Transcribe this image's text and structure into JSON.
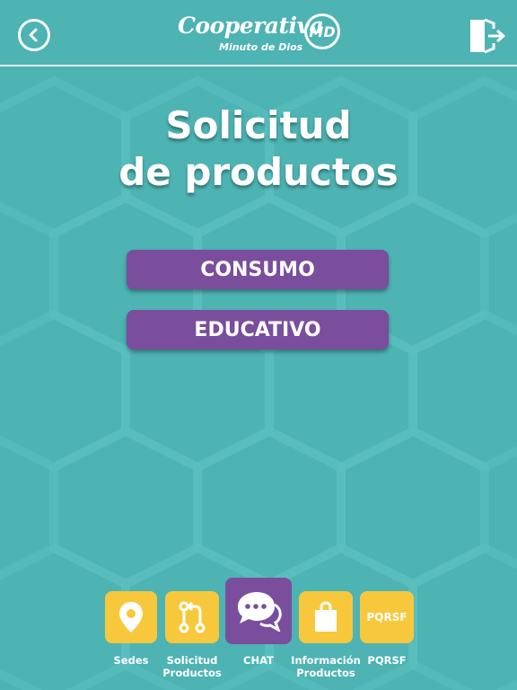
{
  "header": {
    "back_icon": "chevron-left-circle-icon",
    "logo_main": "Cooperativa",
    "logo_sub": "Minuto de Dios",
    "logo_badge": "MD",
    "exit_icon": "logout-door-icon"
  },
  "page": {
    "title_line1": "Solicitud",
    "title_line2": "de productos"
  },
  "buttons": {
    "consumo": "CONSUMO",
    "educativo": "EDUCATIVO"
  },
  "tabbar": {
    "items": [
      {
        "label": "Sedes",
        "icon": "map-pin-icon"
      },
      {
        "label_line1": "Solicitud",
        "label_line2": "Productos",
        "icon": "git-pull-request-icon"
      },
      {
        "label": "CHAT",
        "icon": "chat-bubbles-icon",
        "active": true
      },
      {
        "label_line1": "Información",
        "label_line2": "Productos",
        "icon": "shopping-bag-icon"
      },
      {
        "label": "PQRSF",
        "icon_text": "PQRSF"
      }
    ]
  },
  "colors": {
    "background": "#4db3b3",
    "button_purple": "#7a4e9c",
    "tab_yellow": "#f8c83c",
    "text": "#ffffff"
  }
}
